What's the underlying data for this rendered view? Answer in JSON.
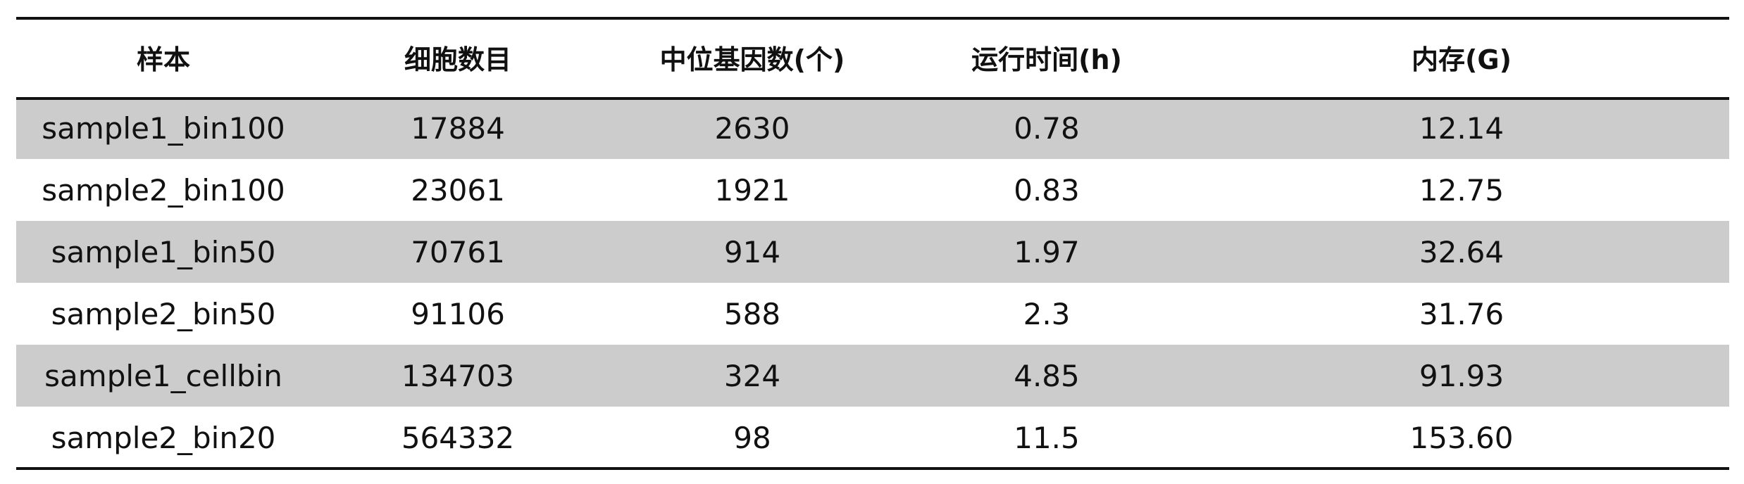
{
  "table": {
    "headers": [
      "样本",
      "细胞数目",
      "中位基因数(个)",
      "运行时间(h)",
      "内存(G)"
    ],
    "rows": [
      [
        "sample1_bin100",
        "17884",
        "2630",
        "0.78",
        "12.14"
      ],
      [
        "sample2_bin100",
        "23061",
        "1921",
        "0.83",
        "12.75"
      ],
      [
        "sample1_bin50",
        "70761",
        "914",
        "1.97",
        "32.64"
      ],
      [
        "sample2_bin50",
        "91106",
        "588",
        "2.3",
        "31.76"
      ],
      [
        "sample1_cellbin",
        "134703",
        "324",
        "4.85",
        "91.93"
      ],
      [
        "sample2_bin20",
        "564332",
        "98",
        "11.5",
        "153.60"
      ]
    ],
    "shade_color": "#cccccc",
    "rule_color": "#111111"
  }
}
